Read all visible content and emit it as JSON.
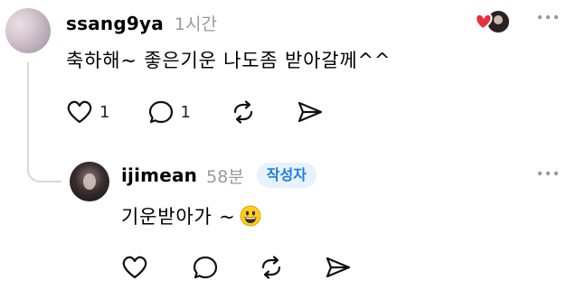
{
  "comment": {
    "username": "ssang9ya",
    "time": "1시간",
    "text": "축하해~ 좋은기운 나도좀 받아갈께^^",
    "like_count": "1",
    "reply_count": "1"
  },
  "reply": {
    "username": "ijimean",
    "time": "58분",
    "badge": "작성자",
    "text": "기운받아가 ~",
    "emoji": "grinning-face"
  },
  "colors": {
    "heart_red": "#e8303f",
    "badge_bg": "#e8f2fc",
    "badge_text": "#1d7bd8",
    "muted": "#9a9a9a"
  }
}
